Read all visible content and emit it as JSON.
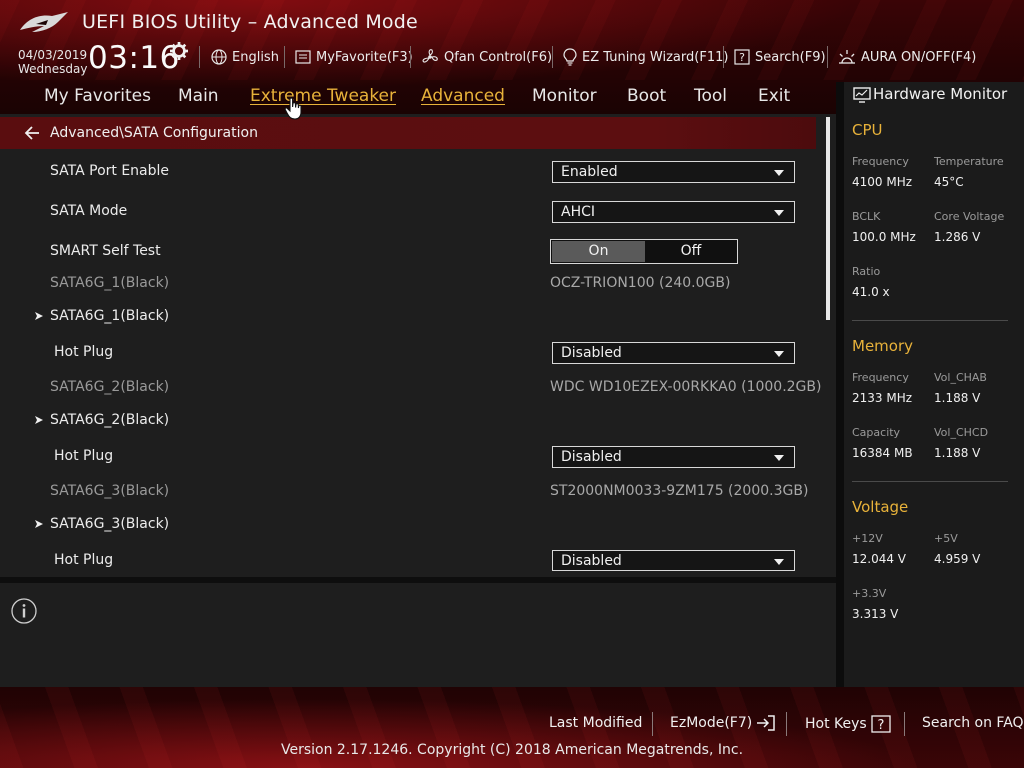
{
  "app": {
    "title": "UEFI BIOS Utility – Advanced Mode"
  },
  "datetime": {
    "date": "04/03/2019",
    "weekday": "Wednesday",
    "time": "03:16"
  },
  "toolbar": {
    "language": "English",
    "my_favorite": "MyFavorite(F3)",
    "qfan": "Qfan Control(F6)",
    "ez_tuning": "EZ Tuning Wizard(F11)",
    "search": "Search(F9)",
    "aura": "AURA ON/OFF(F4)"
  },
  "nav": {
    "tabs": [
      "My Favorites",
      "Main",
      "Extreme Tweaker",
      "Advanced",
      "Monitor",
      "Boot",
      "Tool",
      "Exit"
    ],
    "active": "Advanced",
    "hovered": "Extreme Tweaker"
  },
  "breadcrumb": "Advanced\\SATA Configuration",
  "settings": {
    "sata_port_enable": {
      "label": "SATA Port Enable",
      "value": "Enabled"
    },
    "sata_mode": {
      "label": "SATA Mode",
      "value": "AHCI"
    },
    "smart_self_test": {
      "label": "SMART Self Test",
      "on": "On",
      "off": "Off",
      "selected": "On"
    },
    "ports": [
      {
        "info_label": "SATA6G_1(Black)",
        "device": "OCZ-TRION100 (240.0GB)",
        "submenu": "SATA6G_1(Black)",
        "hotplug_label": "Hot Plug",
        "hotplug_value": "Disabled"
      },
      {
        "info_label": "SATA6G_2(Black)",
        "device": "WDC WD10EZEX-00RKKA0 (1000.2GB)",
        "submenu": "SATA6G_2(Black)",
        "hotplug_label": "Hot Plug",
        "hotplug_value": "Disabled"
      },
      {
        "info_label": "SATA6G_3(Black)",
        "device": "ST2000NM0033-9ZM175 (2000.3GB)",
        "submenu": "SATA6G_3(Black)",
        "hotplug_label": "Hot Plug",
        "hotplug_value": "Disabled"
      }
    ]
  },
  "hardware_monitor": {
    "title": "Hardware Monitor",
    "cpu": {
      "title": "CPU",
      "frequency_label": "Frequency",
      "frequency": "4100 MHz",
      "temperature_label": "Temperature",
      "temperature": "45°C",
      "bclk_label": "BCLK",
      "bclk": "100.0 MHz",
      "core_voltage_label": "Core Voltage",
      "core_voltage": "1.286 V",
      "ratio_label": "Ratio",
      "ratio": "41.0 x"
    },
    "memory": {
      "title": "Memory",
      "frequency_label": "Frequency",
      "frequency": "2133 MHz",
      "vol_chab_label": "Vol_CHAB",
      "vol_chab": "1.188 V",
      "capacity_label": "Capacity",
      "capacity": "16384 MB",
      "vol_chcd_label": "Vol_CHCD",
      "vol_chcd": "1.188 V"
    },
    "voltage": {
      "title": "Voltage",
      "v12_label": "+12V",
      "v12": "12.044 V",
      "v5_label": "+5V",
      "v5": "4.959 V",
      "v33_label": "+3.3V",
      "v33": "3.313 V"
    }
  },
  "footer": {
    "last_modified": "Last Modified",
    "ezmode": "EzMode(F7)",
    "hot_keys": "Hot Keys",
    "search_faq": "Search on FAQ",
    "version": "Version 2.17.1246. Copyright (C) 2018 American Megatrends, Inc."
  },
  "colors": {
    "accent": "#e8b23a",
    "brand_red": "#5a0d0f"
  }
}
